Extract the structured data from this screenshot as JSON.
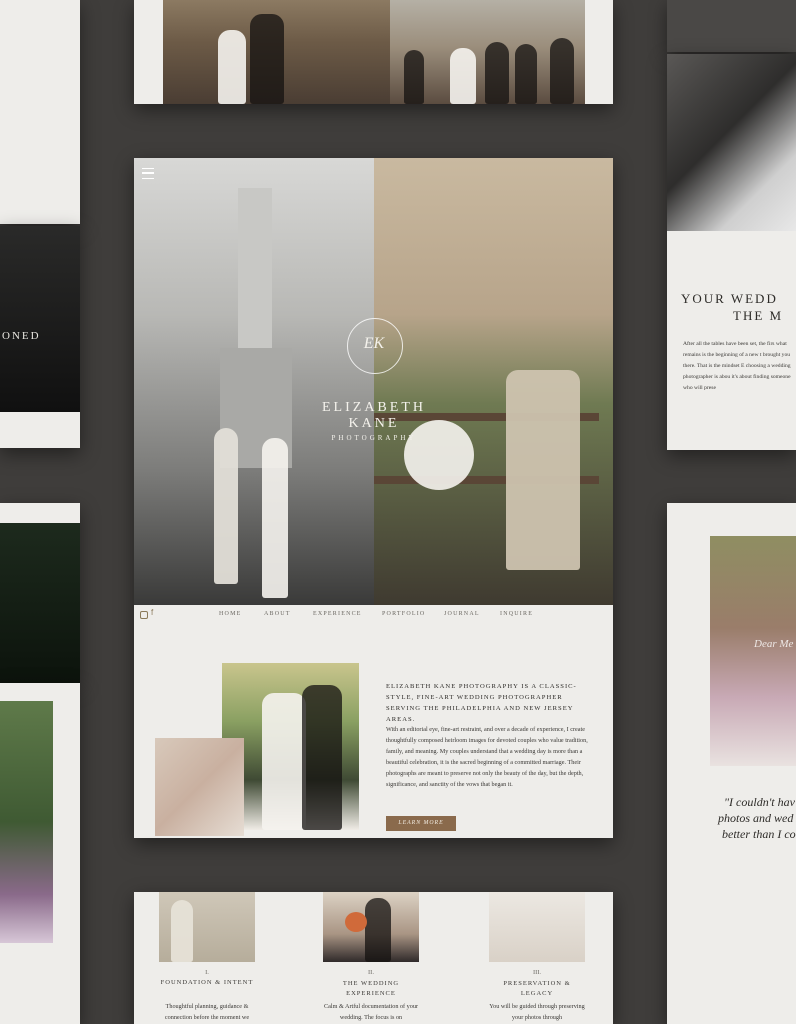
{
  "brand": {
    "name_line1": "ELIZABETH",
    "name_line2": "KANE",
    "name_line3": "PHOTOGRAPHY",
    "monogram": "EK"
  },
  "nav": {
    "menu_icon": "hamburger-icon",
    "social_icons": [
      "instagram-icon",
      "facebook-icon"
    ],
    "items": [
      "HOME",
      "ABOUT",
      "EXPERIENCE",
      "PORTFOLIO",
      "JOURNAL",
      "INQUIRE"
    ]
  },
  "about": {
    "heading": "ELIZABETH KANE PHOTOGRAPHY IS A CLASSIC-STYLE, FINE-ART WEDDING PHOTOGRAPHER SERVING THE PHILADELPHIA AND NEW JERSEY AREAS.",
    "body": "With an editorial eye, fine-art restraint, and over a decade of experience, I create thoughtfully composed heirloom images for devoted couples who value tradition, family, and meaning. My couples understand that a wedding day is more than a beautiful celebration, it is the sacred beginning of a committed marriage. Their photographs are meant to preserve not only the beauty of the day, but the depth, significance, and sanctity of the vows that began it.",
    "button": "LEARN MORE"
  },
  "experience": [
    {
      "num": "I.",
      "title": "FOUNDATION & INTENT",
      "text": "Thoughtful planning, guidance & connection before the moment we"
    },
    {
      "num": "II.",
      "title": "THE WEDDING EXPERIENCE",
      "text": "Calm & Artful documentation of your wedding. The focus is on"
    },
    {
      "num": "III.",
      "title": "PRESERVATION & LEGACY",
      "text": "You will be guided through preserving your photos through"
    }
  ],
  "right_panel": {
    "heading_line1": "YOUR WEDD",
    "heading_line2": "THE M",
    "text": "After all the tables have been set, the firs what remains is the beginning of a new t brought you there. That is the mindset E choosing a wedding photographer is abou it's about finding someone who will prese"
  },
  "left_panel": {
    "partial_word": "ONED"
  },
  "testimonial": {
    "line1": "\"I couldn't hav",
    "line2": "photos and wed",
    "line3": "better than I co"
  },
  "flower_script": "Dear Me"
}
